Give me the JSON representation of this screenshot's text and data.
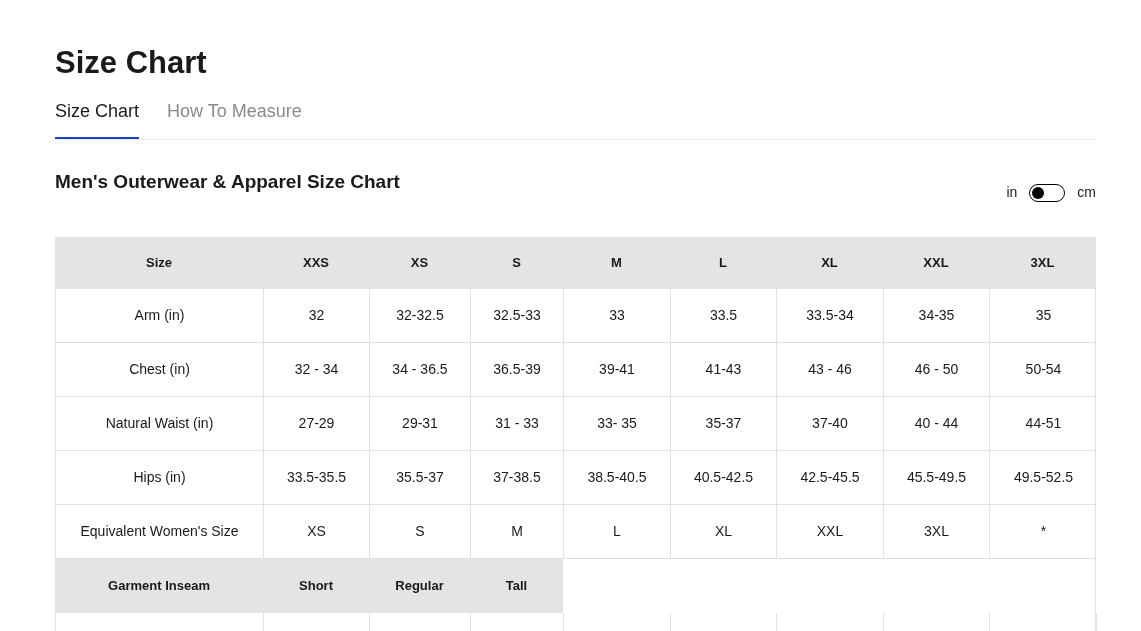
{
  "page_title": "Size Chart",
  "tabs": [
    {
      "label": "Size Chart",
      "selected": true
    },
    {
      "label": "How To Measure",
      "selected": false
    }
  ],
  "chart_title": "Men's Outerwear & Apparel Size Chart",
  "unit_toggle": {
    "left_label": "in",
    "right_label": "cm",
    "on": false
  },
  "table": {
    "columns": [
      "Size",
      "XXS",
      "XS",
      "S",
      "M",
      "L",
      "XL",
      "XXL",
      "3XL"
    ],
    "rows": [
      [
        "Arm (in)",
        "32",
        "32-32.5",
        "32.5-33",
        "33",
        "33.5",
        "33.5-34",
        "34-35",
        "35"
      ],
      [
        "Chest (in)",
        "32 - 34",
        "34 - 36.5",
        "36.5-39",
        "39-41",
        "41-43",
        "43 - 46",
        "46 - 50",
        "50-54"
      ],
      [
        "Natural Waist (in)",
        "27-29",
        "29-31",
        "31 - 33",
        "33- 35",
        "35-37",
        "37-40",
        "40 - 44",
        "44-51"
      ],
      [
        "Hips (in)",
        "33.5-35.5",
        "35.5-37",
        "37-38.5",
        "38.5-40.5",
        "40.5-42.5",
        "42.5-45.5",
        "45.5-49.5",
        "49.5-52.5"
      ],
      [
        "Equivalent Women's Size",
        "XS",
        "S",
        "M",
        "L",
        "XL",
        "XXL",
        "3XL",
        "*"
      ]
    ]
  },
  "inseam_table": {
    "columns": [
      "Garment Inseam",
      "Short",
      "Regular",
      "Tall"
    ]
  }
}
